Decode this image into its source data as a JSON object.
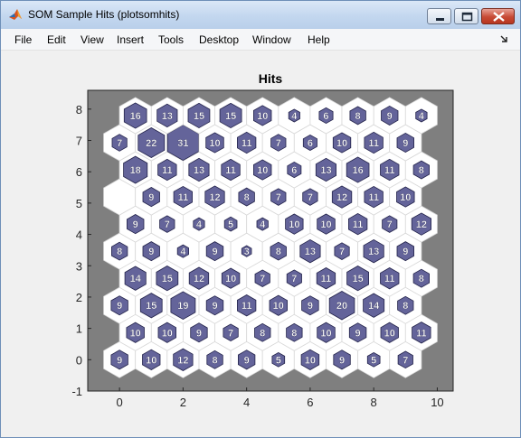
{
  "window": {
    "title": "SOM Sample Hits (plotsomhits)",
    "buttons": {
      "minimize": "minimize",
      "maximize": "maximize",
      "close": "close"
    }
  },
  "menu": {
    "items": [
      {
        "label": "File"
      },
      {
        "label": "Edit"
      },
      {
        "label": "View"
      },
      {
        "label": "Insert"
      },
      {
        "label": "Tools"
      },
      {
        "label": "Desktop"
      },
      {
        "label": "Window"
      },
      {
        "label": "Help"
      }
    ]
  },
  "colors": {
    "plot_background": "#7f7f7f",
    "hex_fill": "#ffffff",
    "hit_fill": "#64649a",
    "title_bar": "#c3d7ef"
  },
  "chart_data": {
    "type": "heatmap",
    "title": "Hits",
    "xlim": [
      -1,
      10.5
    ],
    "ylim": [
      -1,
      8.6
    ],
    "xticks": [
      0,
      2,
      4,
      6,
      8,
      10
    ],
    "yticks": [
      -1,
      0,
      1,
      2,
      3,
      4,
      5,
      6,
      7,
      8
    ],
    "grid": false,
    "layout": "hexagonal 10x10, odd rows offset by 0.5",
    "rows": [
      {
        "y": 0,
        "hits": [
          9,
          10,
          12,
          8,
          9,
          5,
          10,
          9,
          5,
          7
        ]
      },
      {
        "y": 1,
        "hits": [
          10,
          10,
          9,
          7,
          8,
          8,
          10,
          9,
          10,
          11
        ]
      },
      {
        "y": 2,
        "hits": [
          9,
          15,
          19,
          9,
          11,
          10,
          9,
          20,
          14,
          8
        ]
      },
      {
        "y": 3,
        "hits": [
          14,
          15,
          12,
          10,
          7,
          7,
          11,
          15,
          11,
          8
        ]
      },
      {
        "y": 4,
        "hits": [
          8,
          9,
          4,
          9,
          3,
          8,
          13,
          7,
          13,
          9
        ]
      },
      {
        "y": 5,
        "hits": [
          9,
          7,
          4,
          5,
          4,
          10,
          10,
          11,
          7,
          12
        ]
      },
      {
        "y": 6,
        "hits": [
          0,
          9,
          11,
          12,
          8,
          7,
          7,
          12,
          11,
          10
        ]
      },
      {
        "y": 7,
        "hits": [
          18,
          11,
          13,
          11,
          10,
          6,
          13,
          16,
          11,
          8
        ]
      },
      {
        "y": 8,
        "hits": [
          7,
          22,
          31,
          10,
          11,
          7,
          6,
          10,
          11,
          9
        ]
      },
      {
        "y": 9,
        "hits": [
          16,
          13,
          15,
          15,
          10,
          4,
          6,
          8,
          9,
          4
        ]
      }
    ]
  }
}
